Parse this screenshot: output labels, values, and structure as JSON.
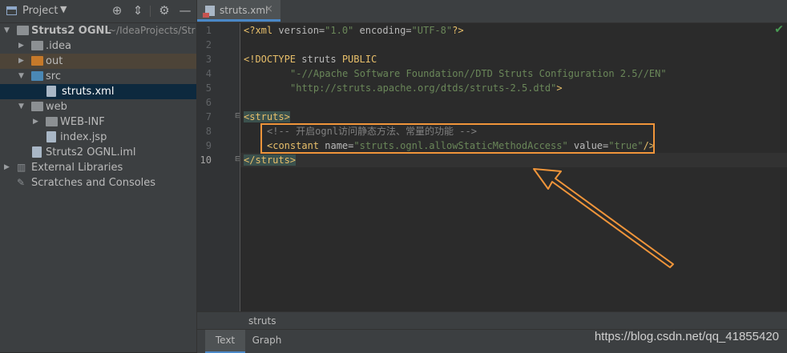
{
  "project_panel": {
    "title": "Project",
    "header_icons": [
      "crosshair-icon",
      "collapse-all-icon",
      "gear-icon",
      "minimize-icon"
    ],
    "tree": [
      {
        "label": "Struts2 OGNL",
        "suffix": "~/IdeaProjects/Str",
        "icon": "module-folder-icon",
        "expanded": true,
        "level": 0
      },
      {
        "label": ".idea",
        "icon": "folder-icon",
        "expanded": false,
        "level": 1
      },
      {
        "label": "out",
        "icon": "excluded-folder-icon",
        "expanded": false,
        "level": 1
      },
      {
        "label": "src",
        "icon": "source-folder-icon",
        "expanded": true,
        "level": 1
      },
      {
        "label": "struts.xml",
        "icon": "xml-file-icon",
        "level": 2,
        "selected": true
      },
      {
        "label": "web",
        "icon": "web-folder-icon",
        "expanded": true,
        "level": 1
      },
      {
        "label": "WEB-INF",
        "icon": "folder-icon",
        "expanded": false,
        "level": 2
      },
      {
        "label": "index.jsp",
        "icon": "jsp-file-icon",
        "level": 2
      },
      {
        "label": "Struts2 OGNL.iml",
        "icon": "iml-file-icon",
        "level": 1
      },
      {
        "label": "External Libraries",
        "icon": "libraries-icon",
        "expanded": false,
        "level": 0
      },
      {
        "label": "Scratches and Consoles",
        "icon": "scratches-icon",
        "level": 0
      }
    ]
  },
  "editor": {
    "tab_label": "struts.xml",
    "line_numbers": [
      "1",
      "2",
      "3",
      "4",
      "5",
      "6",
      "7",
      "8",
      "9",
      "10"
    ],
    "current_line": "10",
    "code": {
      "l1_a": "<?xml ",
      "l1_b": "version=",
      "l1_c": "\"1.0\"",
      "l1_d": " encoding=",
      "l1_e": "\"UTF-8\"",
      "l1_f": "?>",
      "l3_a": "<!DOCTYPE ",
      "l3_b": "struts ",
      "l3_c": "PUBLIC",
      "l4": "\"-//Apache Software Foundation//DTD Struts Configuration 2.5//EN\"",
      "l5_a": "\"http://struts.apache.org/dtds/struts-2.5.dtd\"",
      "l5_b": ">",
      "l7": "<struts>",
      "l8": "<!-- 开启ognl访问静态方法、常量的功能 -->",
      "l9_a": "<constant ",
      "l9_b": "name=",
      "l9_c": "\"struts.ognl.allowStaticMethodAccess\"",
      "l9_d": " value=",
      "l9_e": "\"true\"",
      "l9_f": "/>",
      "l10": "</struts>"
    },
    "breadcrumb": "struts",
    "bottom_tabs": {
      "text": "Text",
      "graph": "Graph"
    }
  },
  "watermark": "https://blog.csdn.net/qq_41855420",
  "colors": {
    "annotation": "#f0953a",
    "accent": "#4a88c7"
  }
}
